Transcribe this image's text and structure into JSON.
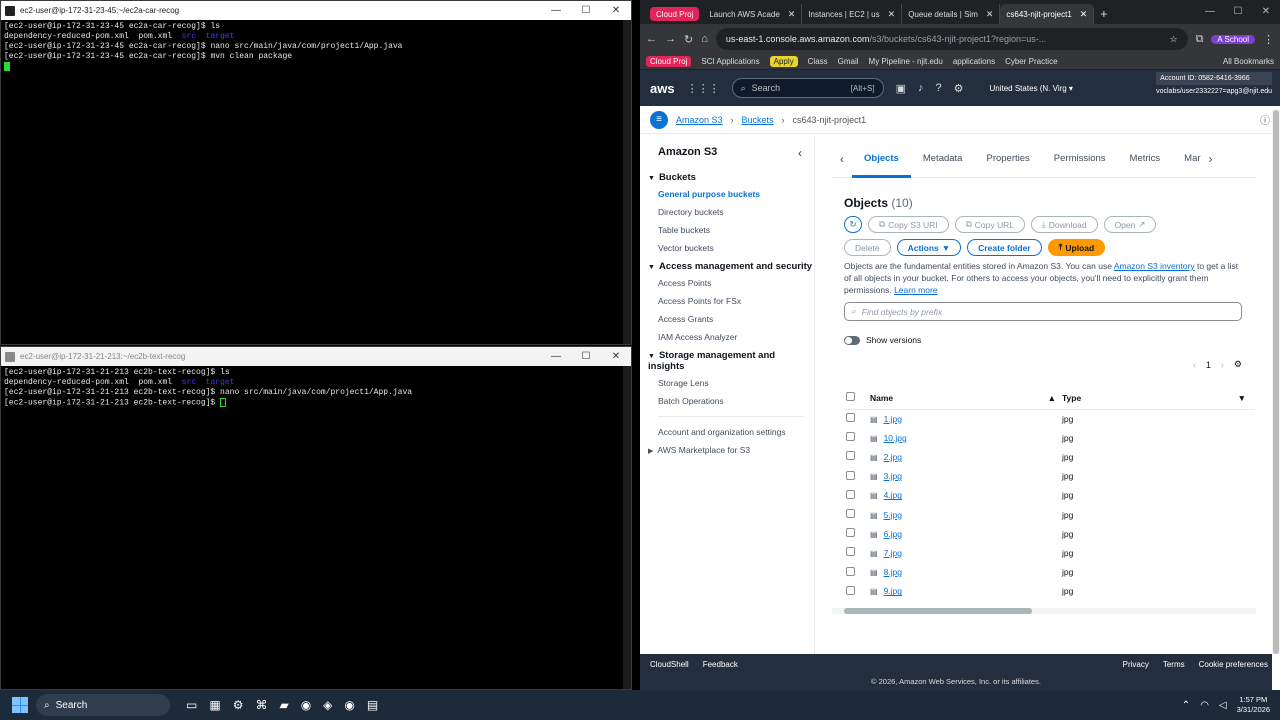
{
  "terminal1": {
    "title": "ec2-user@ip-172-31-23-45:~/ec2a-car-recog",
    "lines": [
      {
        "prompt": "[ec2-user@ip-172-31-23-45 ec2a-car-recog]$ ",
        "cmd": "ls"
      },
      {
        "files": [
          "dependency-reduced-pom.xml",
          "pom.xml"
        ],
        "dirs": [
          "src",
          "target"
        ]
      },
      {
        "prompt": "[ec2-user@ip-172-31-23-45 ec2a-car-recog]$ ",
        "cmd": "nano src/main/java/com/project1/App.java"
      },
      {
        "prompt": "[ec2-user@ip-172-31-23-45 ec2a-car-recog]$ ",
        "cmd": "mvn clean package"
      }
    ]
  },
  "terminal2": {
    "title": "ec2-user@ip-172-31-21-213:~/ec2b-text-recog",
    "lines": [
      {
        "prompt": "[ec2-user@ip-172-31-21-213 ec2b-text-recog]$ ",
        "cmd": "ls"
      },
      {
        "files": [
          "dependency-reduced-pom.xml",
          "pom.xml"
        ],
        "dirs": [
          "src",
          "target"
        ]
      },
      {
        "prompt": "[ec2-user@ip-172-31-21-213 ec2b-text-recog]$ ",
        "cmd": "nano src/main/java/com/project1/App.java"
      },
      {
        "prompt": "[ec2-user@ip-172-31-21-213 ec2b-text-recog]$ ",
        "cmd": ""
      }
    ]
  },
  "window_controls": {
    "minimize": "—",
    "maximize": "☐",
    "close": "✕"
  },
  "browser": {
    "tab_group_label": "Cloud Proj",
    "tabs": [
      {
        "label": "Launch AWS Acade",
        "active": false
      },
      {
        "label": "Instances | EC2 | us",
        "active": false
      },
      {
        "label": "Queue details | Sim",
        "active": false
      },
      {
        "label": "cs643-njit-project1",
        "active": true
      }
    ],
    "new_tab": "+",
    "url_main": "us-east-1.console.aws.amazon.com",
    "url_rest": "/s3/buckets/cs643-njit-project1?region=us-...",
    "bookmarks": [
      "Cloud Proj",
      "SCI Applications",
      "Apply",
      "Class",
      "Gmail",
      "My Pipeline - njit.edu",
      "applications",
      "Cyber Practice",
      "All Bookmarks"
    ]
  },
  "aws": {
    "logo": "aws",
    "search_placeholder": "Search",
    "search_shortcut": "[Alt+S]",
    "region": "United States (N. Virg ▾",
    "account_id": "Account ID: 0582-6416-3966",
    "user": "voclabs/user2332227=apg3@njit.edu"
  },
  "breadcrumb": {
    "items": [
      "Amazon S3",
      "Buckets",
      "cs643-njit-project1"
    ]
  },
  "sidebar": {
    "title": "Amazon S3",
    "sections": [
      {
        "label": "Buckets",
        "items": [
          "General purpose buckets",
          "Directory buckets",
          "Table buckets",
          "Vector buckets"
        ]
      },
      {
        "label": "Access management and security",
        "items": [
          "Access Points",
          "Access Points for FSx",
          "Access Grants",
          "IAM Access Analyzer"
        ]
      },
      {
        "label": "Storage management and insights",
        "items": [
          "Storage Lens",
          "Batch Operations"
        ]
      }
    ],
    "extra": [
      "Account and organization settings",
      "AWS Marketplace for S3"
    ]
  },
  "content_tabs": [
    "Objects",
    "Metadata",
    "Properties",
    "Permissions",
    "Metrics",
    "Mar"
  ],
  "objects": {
    "heading": "Objects",
    "count": "(10)",
    "buttons": {
      "copy_uri": "Copy S3 URI",
      "copy_url": "Copy URL",
      "download": "Download",
      "open": "Open",
      "delete": "Delete",
      "actions": "Actions",
      "create_folder": "Create folder",
      "upload": "Upload"
    },
    "desc_1": "Objects are the fundamental entities stored in Amazon S3. You can use ",
    "desc_link": "Amazon S3 inventory",
    "desc_2": " to get a list of all objects in your bucket. For others to access your objects, you'll need to explicitly grant them permissions. ",
    "learn_more": "Learn more",
    "find_placeholder": "Find objects by prefix",
    "show_versions": "Show versions",
    "page": "1",
    "columns": [
      "Name",
      "Type"
    ],
    "rows": [
      {
        "name": "1.jpg",
        "type": "jpg"
      },
      {
        "name": "10.jpg",
        "type": "jpg"
      },
      {
        "name": "2.jpg",
        "type": "jpg"
      },
      {
        "name": "3.jpg",
        "type": "jpg"
      },
      {
        "name": "4.jpg",
        "type": "jpg"
      },
      {
        "name": "5.jpg",
        "type": "jpg"
      },
      {
        "name": "6.jpg",
        "type": "jpg"
      },
      {
        "name": "7.jpg",
        "type": "jpg"
      },
      {
        "name": "8.jpg",
        "type": "jpg"
      },
      {
        "name": "9.jpg",
        "type": "jpg"
      }
    ]
  },
  "footer": {
    "cloudshell": "CloudShell",
    "feedback": "Feedback",
    "privacy": "Privacy",
    "terms": "Terms",
    "cookies": "Cookie preferences",
    "copyright": "© 2026, Amazon Web Services, Inc. or its affiliates."
  },
  "taskbar": {
    "search": "Search",
    "time": "1:57 PM",
    "date": "3/31/2026"
  },
  "colors": {
    "aws_nav": "#232f3e",
    "aws_orange": "#ff9900",
    "link_blue": "#0972d3",
    "terminal_green": "#2fd72f",
    "cloud_proj": "#e3245a"
  }
}
